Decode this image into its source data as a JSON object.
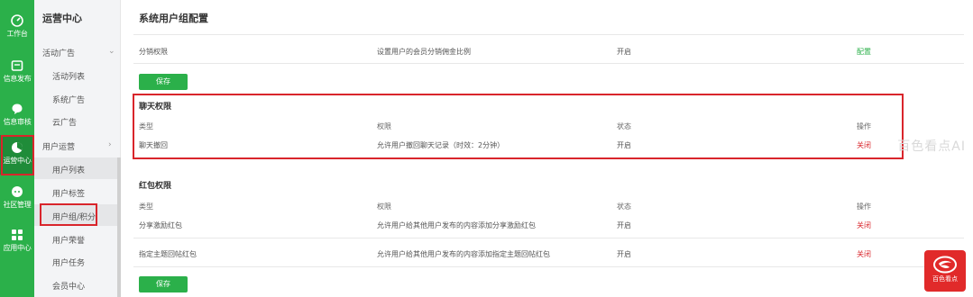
{
  "rail": [
    {
      "label": "工作台",
      "icon": "dashboard-icon"
    },
    {
      "label": "信息发布",
      "icon": "publish-icon"
    },
    {
      "label": "信息审核",
      "icon": "review-icon"
    },
    {
      "label": "运营中心",
      "icon": "operations-icon",
      "active": true
    },
    {
      "label": "社区管理",
      "icon": "community-icon"
    },
    {
      "label": "应用中心",
      "icon": "apps-icon"
    }
  ],
  "submenu": {
    "title": "运营中心",
    "group1": "活动广告",
    "items1": [
      "活动列表",
      "系统广告",
      "云广告"
    ],
    "group2": "用户运营",
    "items2": [
      "用户列表",
      "用户标签",
      "用户组/积分",
      "用户荣誉",
      "用户任务",
      "会员中心"
    ]
  },
  "main": {
    "title": "系统用户组配置",
    "commission": {
      "type": "分销权限",
      "desc": "设置用户的会员分销佣金比例",
      "status": "开启",
      "action": "配置"
    },
    "save_label": "保存",
    "chat": {
      "title": "聊天权限",
      "headers": {
        "type": "类型",
        "perm": "权限",
        "status": "状态",
        "action": "操作"
      },
      "rows": [
        {
          "type": "聊天撤回",
          "perm": "允许用户撤回聊天记录（时效：2分钟）",
          "status": "开启",
          "action": "关闭"
        }
      ]
    },
    "redpacket": {
      "title": "红包权限",
      "headers": {
        "type": "类型",
        "perm": "权限",
        "status": "状态",
        "action": "操作"
      },
      "rows": [
        {
          "type": "分享激励红包",
          "perm": "允许用户给其他用户发布的内容添加分享激励红包",
          "status": "开启",
          "action": "关闭"
        },
        {
          "type": "指定主题回帖红包",
          "perm": "允许用户给其他用户发布的内容添加指定主题回帖红包",
          "status": "开启",
          "action": "关闭"
        }
      ]
    }
  },
  "watermark": "百色看点AI",
  "badge_text": "百色看点",
  "colors": {
    "accent": "#2bb04a",
    "highlight": "#d9252b"
  }
}
